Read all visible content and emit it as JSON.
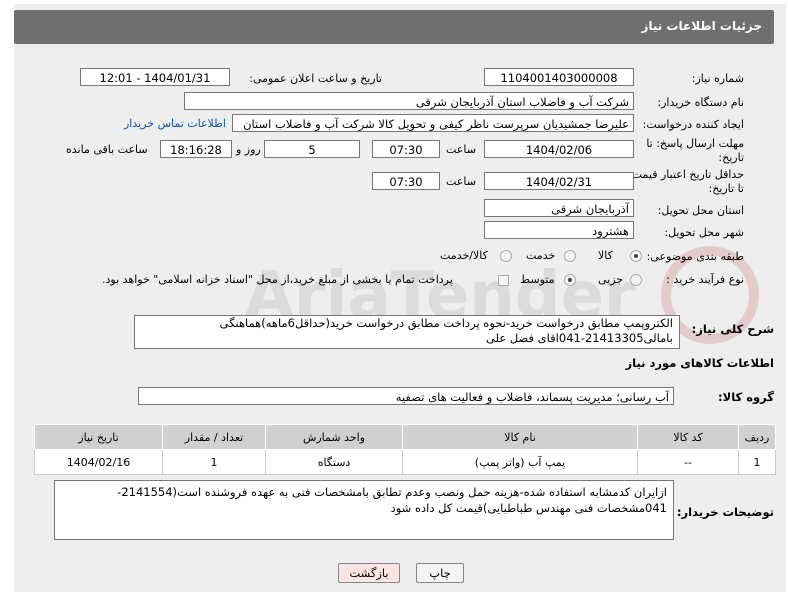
{
  "header": {
    "title": "جزئیات اطلاعات نیاز"
  },
  "fields": {
    "need_number_label": "شماره نیاز:",
    "need_number": "1104001403000008",
    "announce_label": "تاریخ و ساعت اعلان عمومی:",
    "announce_value": "1404/01/31 - 12:01",
    "buyer_org_label": "نام دستگاه خریدار:",
    "buyer_org": "شرکت آب و فاضلاب استان آذربایجان شرقی",
    "creator_label": "ایجاد کننده درخواست:",
    "creator": "علیرضا جمشیدیان سرپرست ناظر کیفی و تحویل کالا شرکت آب و فاضلاب استان",
    "contact_link": "اطلاعات تماس خریدار",
    "deadline_label_1": "مهلت ارسال پاسخ: تا",
    "deadline_label_2": "تاریخ:",
    "deadline_date": "1404/02/06",
    "hour_label": "ساعت",
    "deadline_time": "07:30",
    "day_and_label": "روز و",
    "days": "5",
    "remaining_time": "18:16:28",
    "remaining_label": "ساعت باقی مانده",
    "validity_label_1": "حداقل تاریخ اعتبار قیمت:",
    "validity_label_2": "تا تاریخ:",
    "validity_date": "1404/02/31",
    "validity_time": "07:30",
    "province_label": "استان محل تحویل:",
    "province": "آذربایجان شرقی",
    "city_label": "شهر محل تحویل:",
    "city": "هشترود",
    "category_label": "طبقه بندی موضوعی:",
    "category_options": [
      "کالا",
      "خدمت",
      "کالا/خدمت"
    ],
    "process_label": "نوع فرآیند خرید :",
    "process_options": [
      "جزیی",
      "متوسط"
    ],
    "payment_note": "پرداخت تمام یا بخشی از مبلغ خرید،از محل \"اسناد خزانه اسلامی\" خواهد بود."
  },
  "description": {
    "label": "شرح کلی نیاز:",
    "text": "الکتروپمپ مطابق درخواست خرید-نحوه پرداخت مطابق درخواست خرید(حداقل6ماهه)هماهنگی بامالی21413305-041اقای فضل علی"
  },
  "goods_section": {
    "title": "اطلاعات کالاهای مورد نیاز"
  },
  "goods_group": {
    "label": "گروه کالا:",
    "value": "آب رسانی؛ مدیریت پسماند، فاضلاب و فعالیت های تصفیه"
  },
  "table": {
    "headers": [
      "ردیف",
      "کد کالا",
      "نام کالا",
      "واحد شمارش",
      "تعداد / مقدار",
      "تاریخ نیاز"
    ],
    "rows": [
      [
        "1",
        "--",
        "پمپ آب (واتر پمپ)",
        "دستگاه",
        "1",
        "1404/02/16"
      ]
    ]
  },
  "buyer_notes": {
    "label": "توضیحات خریدار:",
    "text": "ازایران کدمشابه استفاده شده-هزینه حمل ونصب وعدم تطابق بامشخصات فنی به عهده فروشنده است(2141554-041مشخصات فنی مهندس طباطبایی)قیمت کل داده شود"
  },
  "buttons": {
    "print": "چاپ",
    "back": "بازگشت"
  },
  "colors": {
    "header_bg": "#6f6f6f",
    "link": "#0b52a6",
    "back_button_bg": "#fbe4e4"
  }
}
